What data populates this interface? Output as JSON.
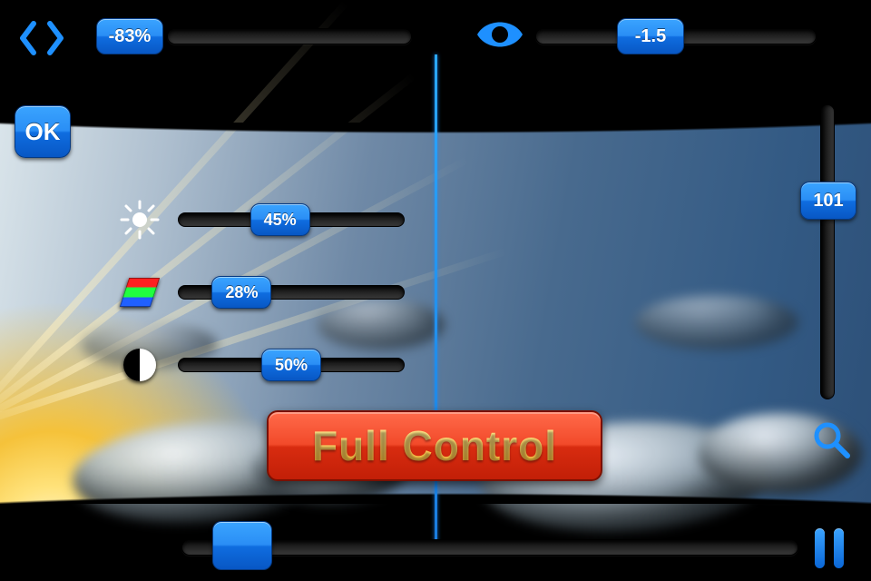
{
  "top": {
    "separation": {
      "value_label": "-83%",
      "value": -83
    },
    "exposure": {
      "value_label": "-1.5",
      "value": -1.5
    }
  },
  "ok_button": {
    "label": "OK"
  },
  "adjust": {
    "brightness": {
      "value_label": "45%",
      "fraction": 0.45,
      "icon": "brightness-icon"
    },
    "saturation": {
      "value_label": "28%",
      "fraction": 0.28,
      "icon": "saturation-icon"
    },
    "contrast": {
      "value_label": "50%",
      "fraction": 0.5,
      "icon": "contrast-icon"
    }
  },
  "focal": {
    "value_label": "101",
    "value": 101
  },
  "banner": {
    "label": "Full Control"
  },
  "colors": {
    "accent": "#1e80e8"
  }
}
